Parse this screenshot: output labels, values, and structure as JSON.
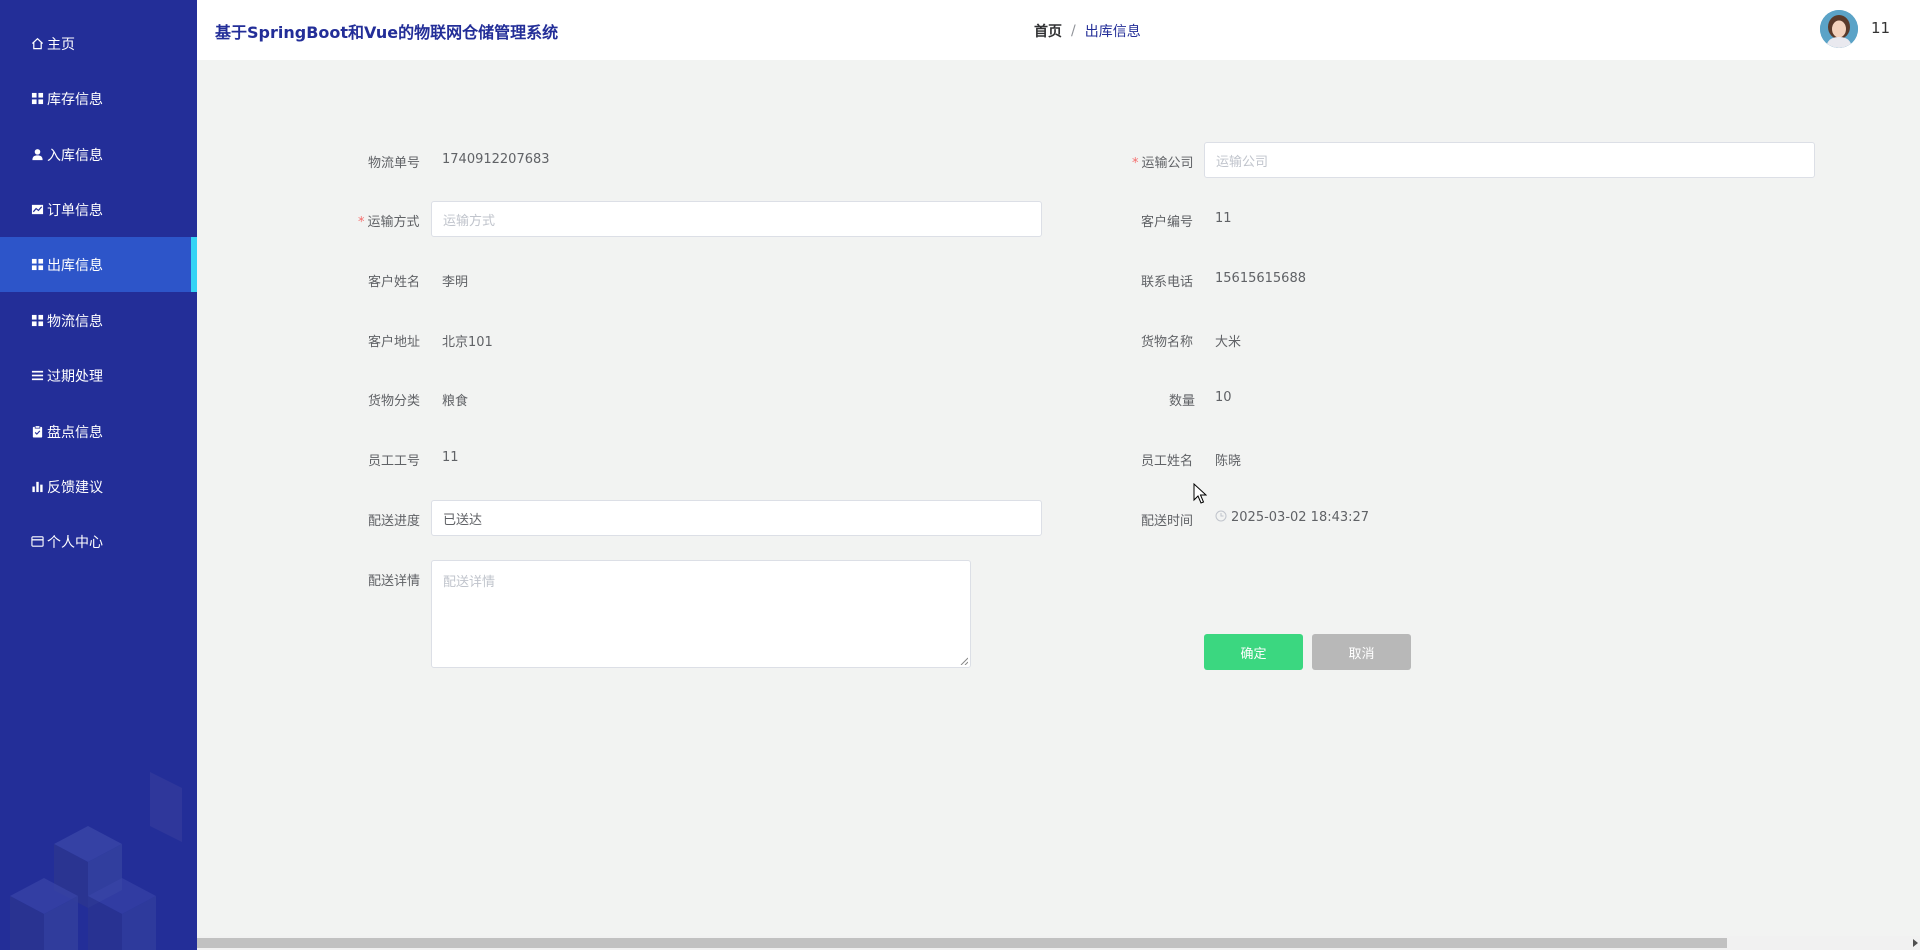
{
  "app": {
    "title": "基于SpringBoot和Vue的物联网仓储管理系统",
    "username": "11"
  },
  "colors": {
    "sidebar": "#232e98",
    "active_item": "#2d55c9",
    "active_marker": "#34d3f5",
    "confirm": "#3bd780",
    "cancel": "#b8b8b8",
    "required": "#f56c6c"
  },
  "sidebar": {
    "items": [
      {
        "label": "主页",
        "icon": "home-icon"
      },
      {
        "label": "库存信息",
        "icon": "grid-icon"
      },
      {
        "label": "入库信息",
        "icon": "user-icon"
      },
      {
        "label": "订单信息",
        "icon": "chart-icon"
      },
      {
        "label": "出库信息",
        "icon": "grid-icon",
        "active": true
      },
      {
        "label": "物流信息",
        "icon": "grid-icon"
      },
      {
        "label": "过期处理",
        "icon": "list-icon"
      },
      {
        "label": "盘点信息",
        "icon": "clipboard-icon"
      },
      {
        "label": "反馈建议",
        "icon": "bar-chart-icon"
      },
      {
        "label": "个人中心",
        "icon": "card-icon"
      }
    ]
  },
  "breadcrumb": {
    "home": "首页",
    "separator": "/",
    "current": "出库信息"
  },
  "form": {
    "tracking_no": {
      "label": "物流单号",
      "value": "1740912207683"
    },
    "transport_company": {
      "label": "运输公司",
      "placeholder": "运输公司",
      "required": true
    },
    "transport_method": {
      "label": "运输方式",
      "placeholder": "运输方式",
      "required": true
    },
    "customer_no": {
      "label": "客户编号",
      "value": "11"
    },
    "customer_name": {
      "label": "客户姓名",
      "value": "李明"
    },
    "phone": {
      "label": "联系电话",
      "value": "15615615688"
    },
    "customer_address": {
      "label": "客户地址",
      "value": "北京101"
    },
    "goods_name": {
      "label": "货物名称",
      "value": "大米"
    },
    "goods_category": {
      "label": "货物分类",
      "value": "粮食"
    },
    "quantity": {
      "label": "数量",
      "value": "10"
    },
    "employee_no": {
      "label": "员工工号",
      "value": "11"
    },
    "employee_name": {
      "label": "员工姓名",
      "value": "陈晓"
    },
    "delivery_progress": {
      "label": "配送进度",
      "value": "已送达"
    },
    "delivery_time": {
      "label": "配送时间",
      "value": "2025-03-02 18:43:27"
    },
    "delivery_detail": {
      "label": "配送详情",
      "placeholder": "配送详情"
    }
  },
  "buttons": {
    "confirm": "确定",
    "cancel": "取消"
  }
}
